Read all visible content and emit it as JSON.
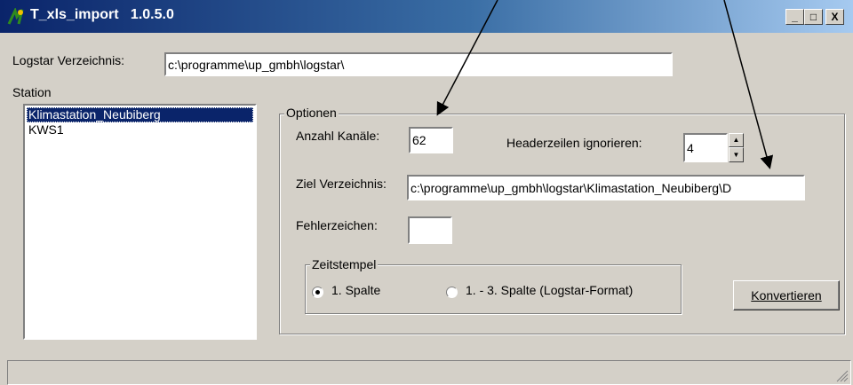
{
  "window": {
    "title": "T_xls_import   1.0.5.0"
  },
  "title_buttons": {
    "minimize": "_",
    "maximize": "□",
    "close": "X"
  },
  "logstar": {
    "label": "Logstar Verzeichnis:",
    "value": "c:\\programme\\up_gmbh\\logstar\\"
  },
  "station": {
    "label": "Station",
    "items": [
      "Klimastation_Neubiberg",
      "KWS1"
    ]
  },
  "options": {
    "group_title": "Optionen",
    "anzahl_label": "Anzahl Kanäle:",
    "anzahl_value": "62",
    "header_label": "Headerzeilen ignorieren:",
    "header_value": "4",
    "ziel_label": "Ziel Verzeichnis:",
    "ziel_value": "c:\\programme\\up_gmbh\\logstar\\Klimastation_Neubiberg\\D",
    "fehler_label": "Fehlerzeichen:",
    "fehler_value": ""
  },
  "zeitstempel": {
    "group_title": "Zeitstempel",
    "option1": "1. Spalte",
    "option2": "1. - 3. Spalte (Logstar-Format)",
    "selected": "option1"
  },
  "convert_button": {
    "label": "Konvertieren"
  }
}
